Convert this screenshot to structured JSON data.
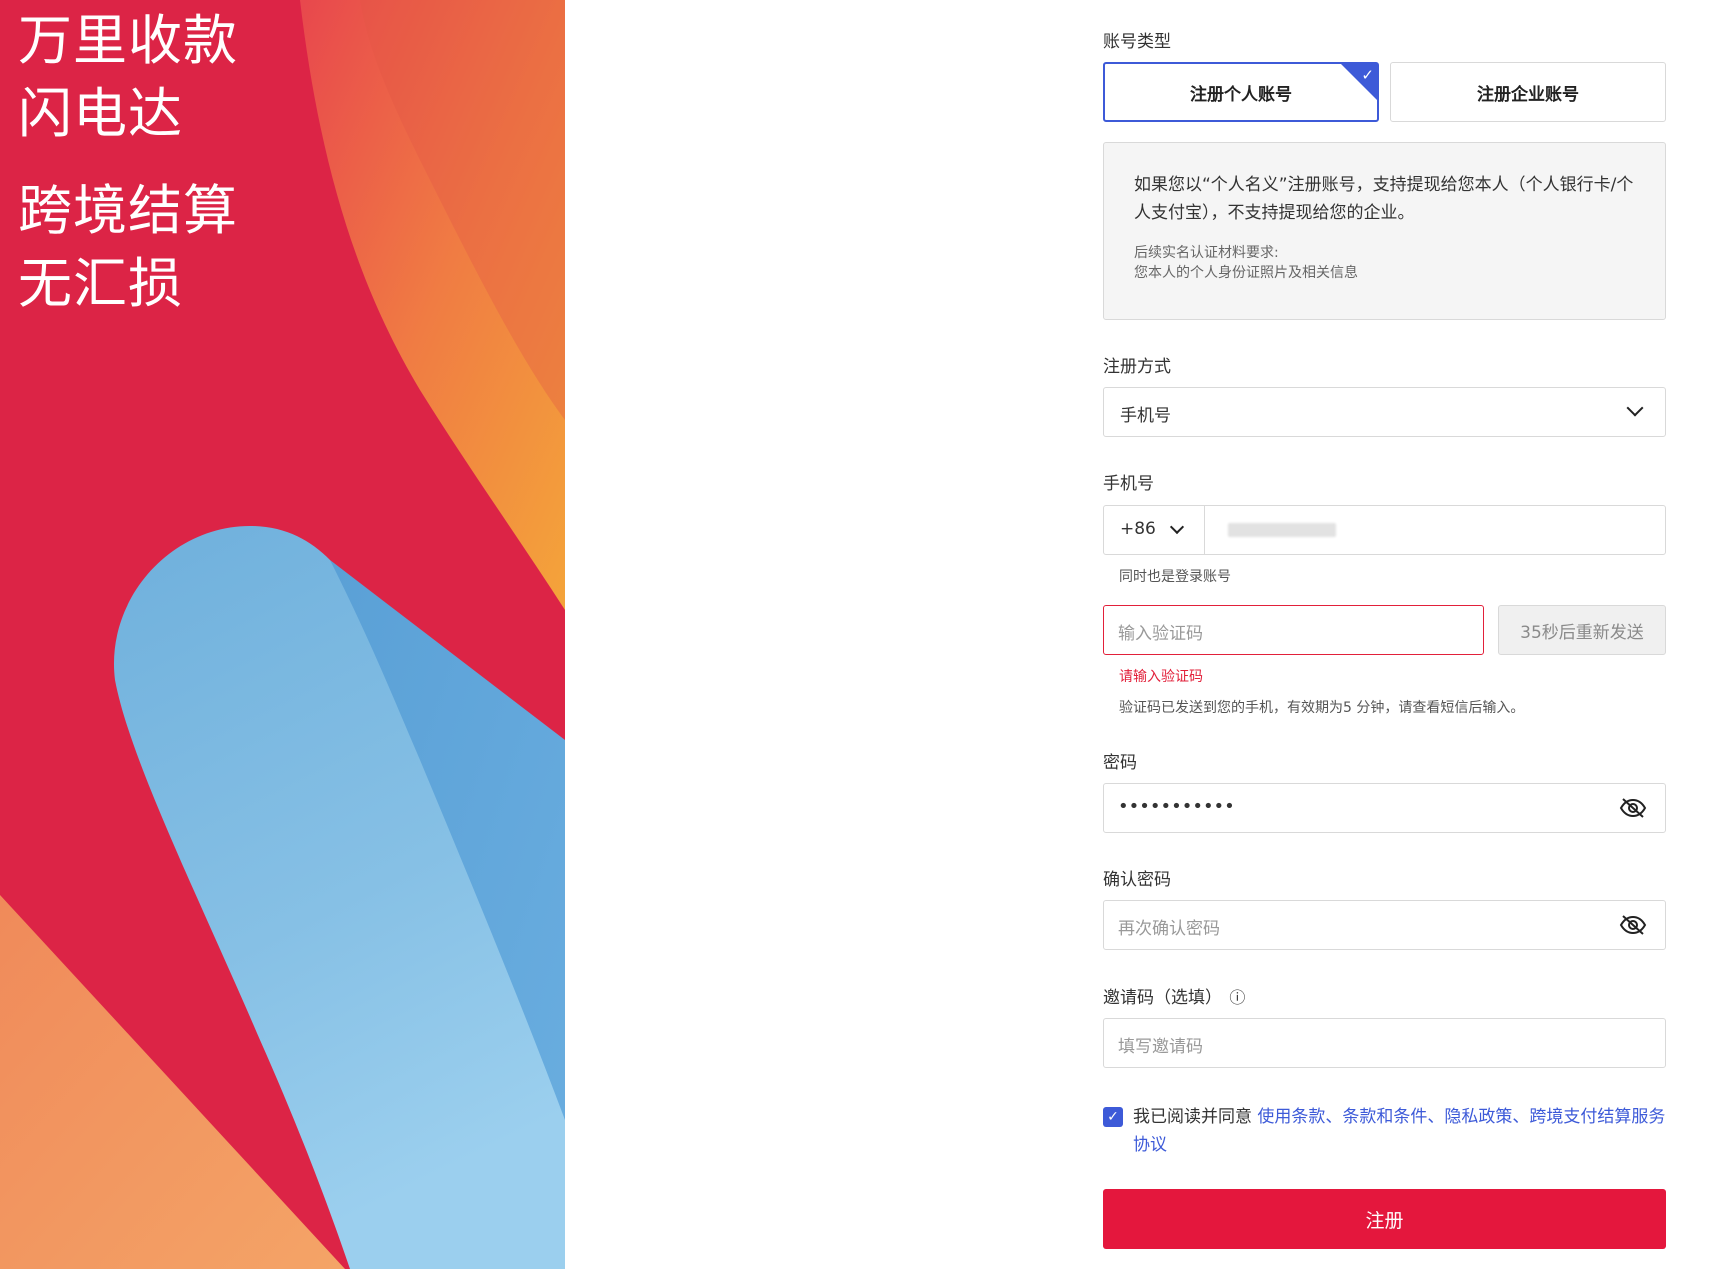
{
  "hero": {
    "line1": "万里收款",
    "line2": "闪电达",
    "line3": "跨境结算",
    "line4": "无汇损"
  },
  "account_type": {
    "label": "账号类型",
    "personal": "注册个人账号",
    "business": "注册企业账号",
    "selected": "personal",
    "info_main": "如果您以“个人名义”注册账号，支持提现给您本人（个人银行卡/个人支付宝），不支持提现给您的企业。",
    "info_sub_title": "后续实名认证材料要求:",
    "info_sub_body": "您本人的个人身份证照片及相关信息"
  },
  "register_method": {
    "label": "注册方式",
    "value": "手机号"
  },
  "phone": {
    "label": "手机号",
    "country_code": "+86",
    "hint": "同时也是登录账号"
  },
  "verify": {
    "placeholder": "输入验证码",
    "resend": "35秒后重新发送",
    "error": "请输入验证码",
    "hint": "验证码已发送到您的手机，有效期为5 分钟，请查看短信后输入。"
  },
  "password": {
    "label": "密码",
    "value": "•••••••••••"
  },
  "confirm_password": {
    "label": "确认密码",
    "placeholder": "再次确认密码"
  },
  "invite": {
    "label": "邀请码（选填）",
    "info_icon": "ⓘ",
    "placeholder": "填写邀请码"
  },
  "agreement": {
    "checked": true,
    "prefix": "我已阅读并同意 ",
    "link1": "使用条款",
    "sep1": "、",
    "link2": "条款和条件",
    "sep2": "、",
    "link3": "隐私政策",
    "sep3": "、",
    "link4": "跨境支付结算服务协议"
  },
  "submit": {
    "label": "注册"
  },
  "colors": {
    "accent": "#3d5ad8",
    "brand_red": "#e4173d",
    "error": "#e2203a"
  }
}
